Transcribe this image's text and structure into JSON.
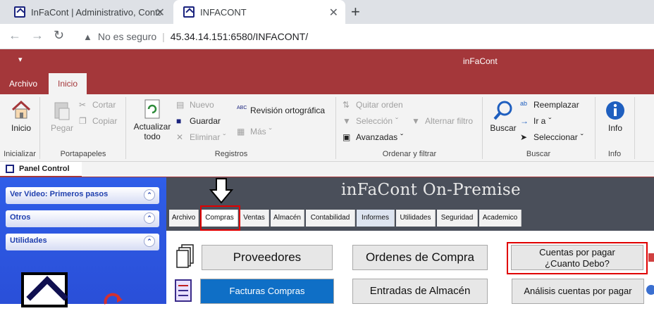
{
  "browser": {
    "tabs": [
      {
        "title": "InFaCont | Administrativo, Contab"
      },
      {
        "title": "INFACONT"
      }
    ],
    "address": {
      "security": "No es seguro",
      "url": "45.34.14.151:6580/INFACONT/"
    }
  },
  "app": {
    "title": "inFaCont",
    "ribbon_tabs": [
      "Archivo",
      "Inicio"
    ],
    "groups": {
      "inicializar": {
        "label": "Inicializar",
        "inicio": "Inicio"
      },
      "portapapeles": {
        "label": "Portapapeles",
        "pegar": "Pegar",
        "cortar": "Cortar",
        "copiar": "Copiar"
      },
      "registros": {
        "label": "Registros",
        "actualizar1": "Actualizar",
        "actualizar2": "todo",
        "nuevo": "Nuevo",
        "guardar": "Guardar",
        "eliminar": "Eliminar",
        "revision": "Revisión ortográfica",
        "mas": "Más"
      },
      "ordenar": {
        "label": "Ordenar y filtrar",
        "quitar": "Quitar orden",
        "seleccion": "Selección",
        "avanzadas": "Avanzadas",
        "alternar": "Alternar filtro"
      },
      "buscar": {
        "label": "Buscar",
        "buscar": "Buscar",
        "reemplazar": "Reemplazar",
        "ira": "Ir a",
        "seleccionar": "Seleccionar"
      },
      "info": {
        "label": "Info",
        "info": "Info"
      }
    },
    "doc_tab": "Panel Control"
  },
  "left_panel": {
    "items": [
      "Ver Video: Primeros pasos",
      "Otros",
      "Utilidades"
    ]
  },
  "main": {
    "banner": "inFaCont On-Premise",
    "tabs": [
      "Archivo",
      "Compras",
      "Ventas",
      "Almacén",
      "Contabilidad",
      "Informes",
      "Utilidades",
      "Seguridad",
      "Academico"
    ],
    "buttons": {
      "proveedores": "Proveedores",
      "ordenes": "Ordenes de Compra",
      "cuentas1": "Cuentas por pagar",
      "cuentas2": "¿Cuanto Debo?",
      "facturas": "Facturas Compras",
      "entradas": "Entradas de Almacén",
      "analisis": "Análisis cuentas por pagar"
    }
  },
  "colors": {
    "accent": "#a4373a",
    "panel_blue": "#2f5ee8",
    "highlight": "#e00000",
    "button_blue": "#0f6fc6"
  }
}
